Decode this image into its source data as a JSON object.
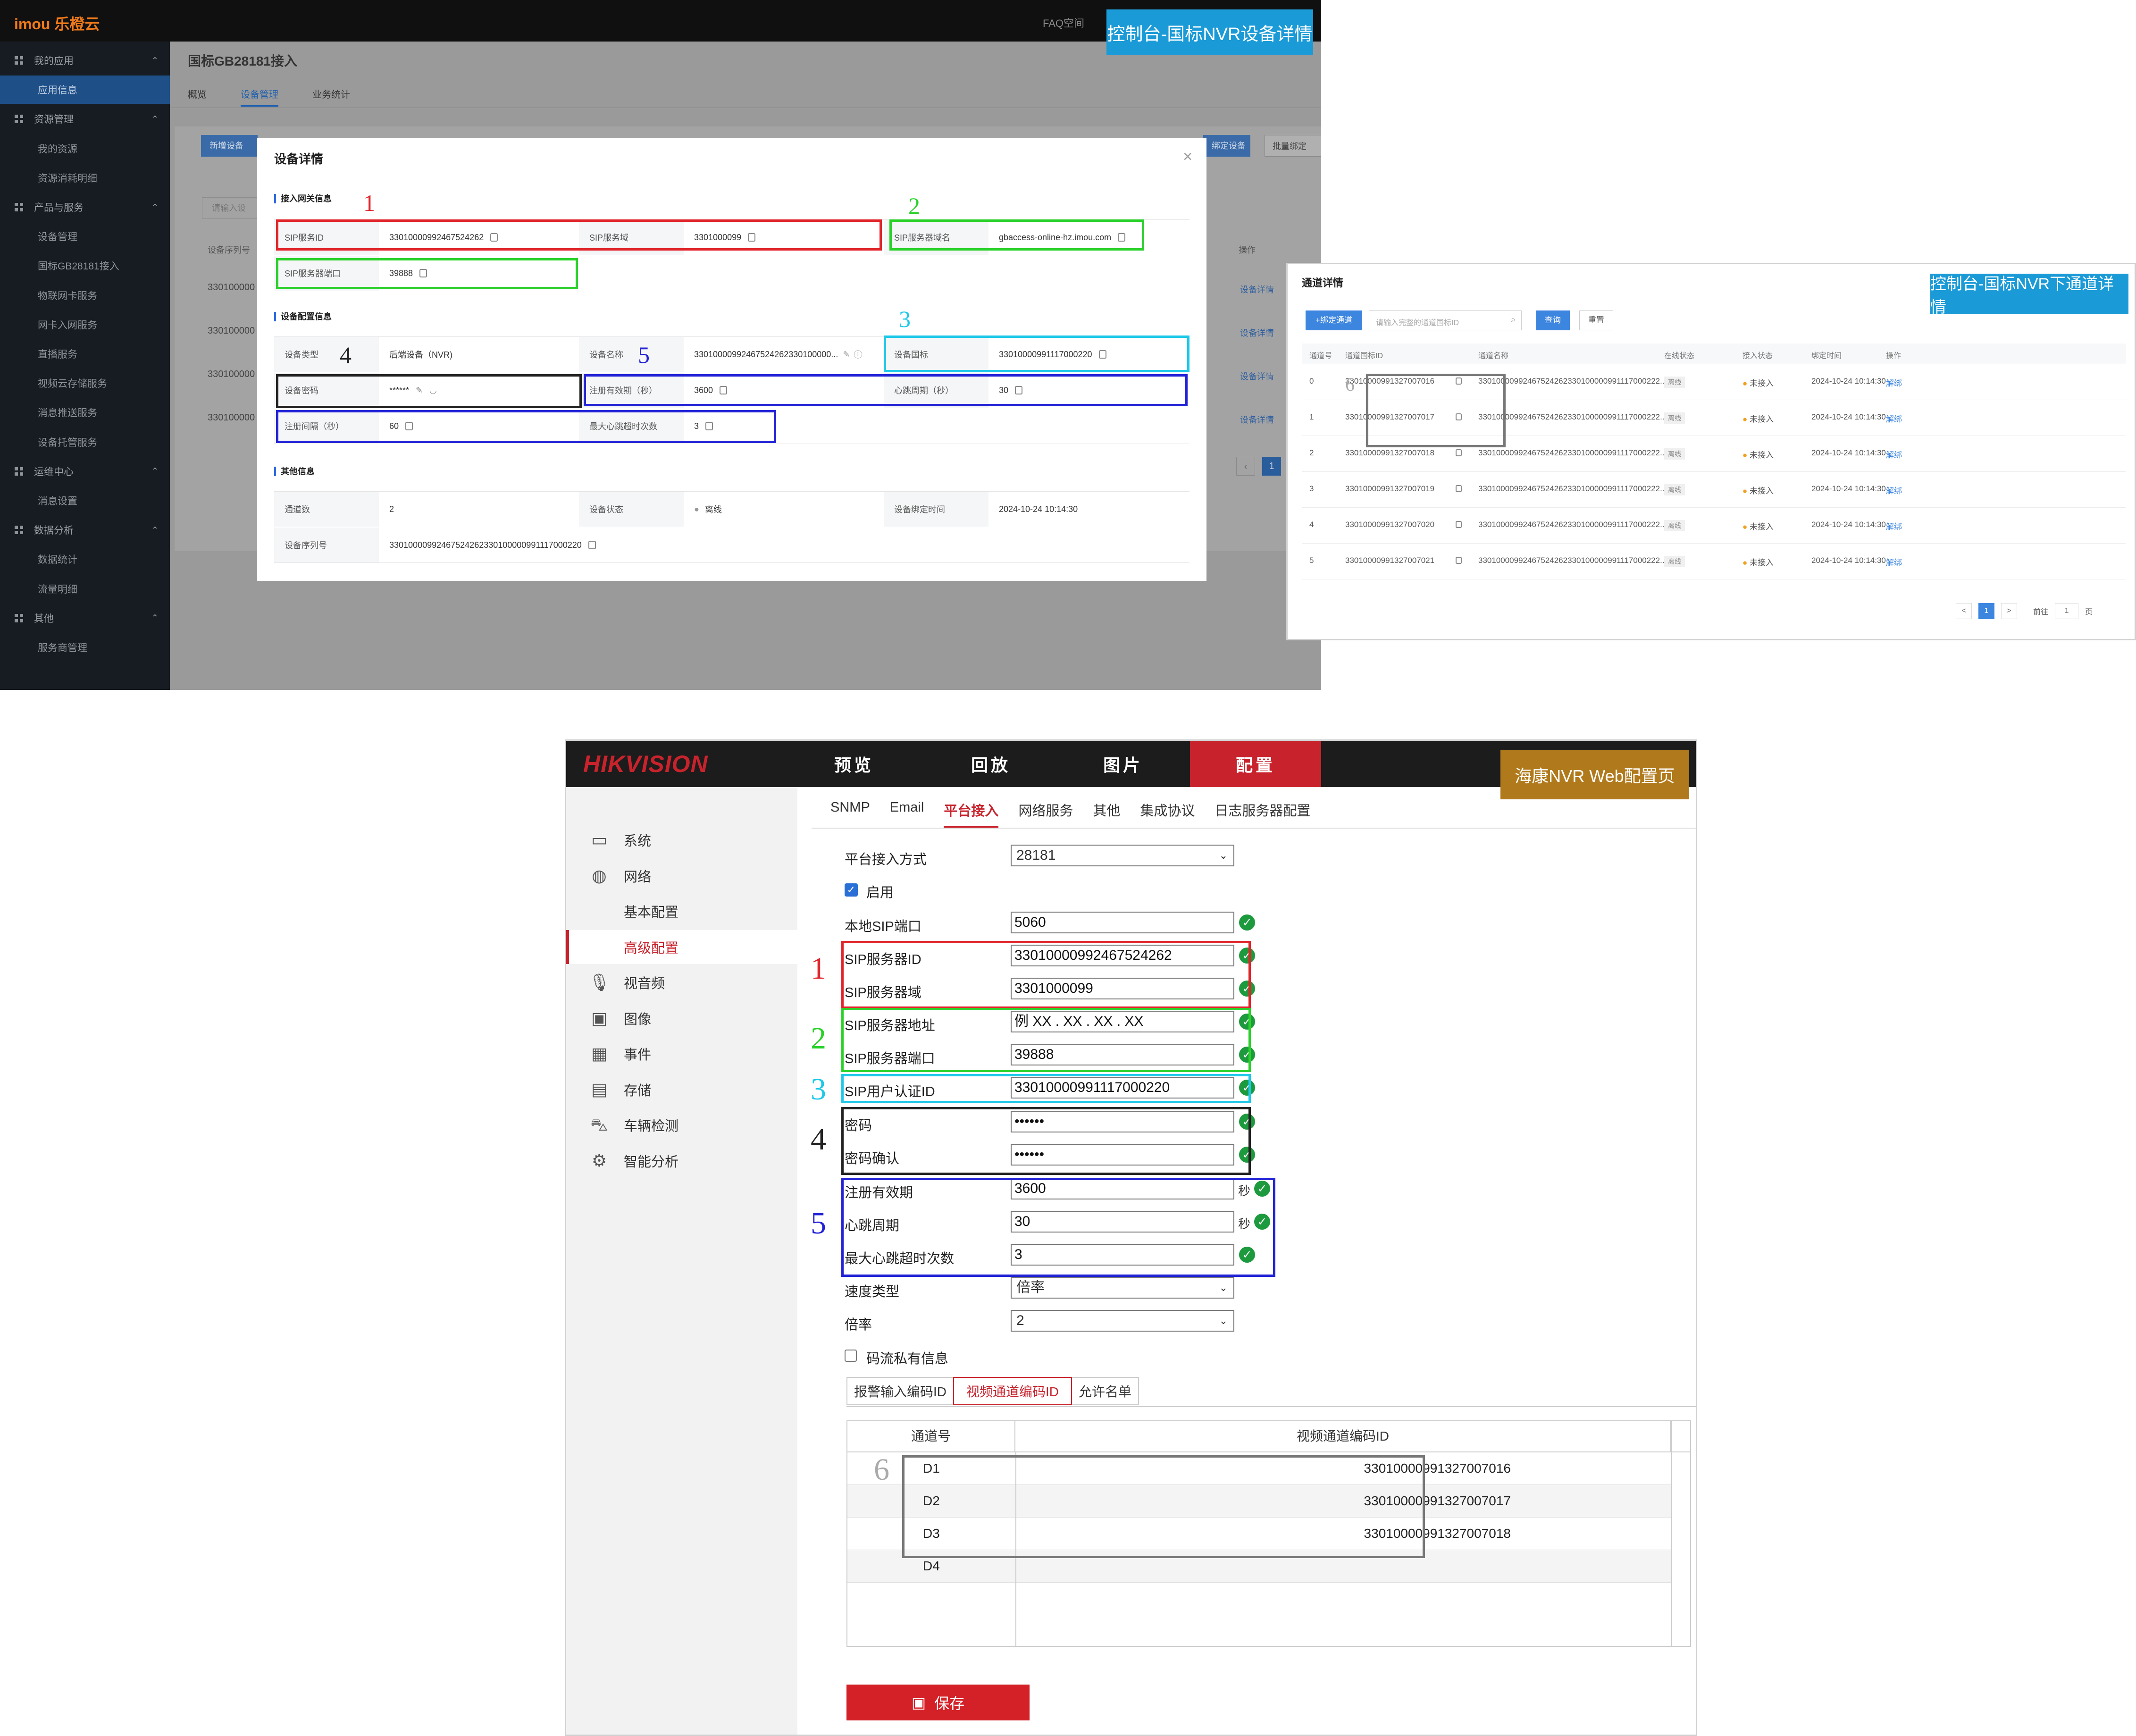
{
  "imou": {
    "brand": "imou 乐橙云",
    "faq": "FAQ空间",
    "caption": "控制台-国标NVR设备详情",
    "sidebar": [
      {
        "label": "我的应用",
        "type": "group",
        "icon": "apps-icon"
      },
      {
        "label": "应用信息",
        "type": "sub",
        "active": true
      },
      {
        "label": "资源管理",
        "type": "group",
        "icon": "resource-icon"
      },
      {
        "label": "我的资源",
        "type": "sub"
      },
      {
        "label": "资源消耗明细",
        "type": "sub"
      },
      {
        "label": "产品与服务",
        "type": "group",
        "icon": "product-icon"
      },
      {
        "label": "设备管理",
        "type": "sub"
      },
      {
        "label": "国标GB28181接入",
        "type": "sub"
      },
      {
        "label": "物联网卡服务",
        "type": "sub"
      },
      {
        "label": "网卡入网服务",
        "type": "sub"
      },
      {
        "label": "直播服务",
        "type": "sub"
      },
      {
        "label": "视频云存储服务",
        "type": "sub"
      },
      {
        "label": "消息推送服务",
        "type": "sub"
      },
      {
        "label": "设备托管服务",
        "type": "sub"
      },
      {
        "label": "运维中心",
        "type": "group",
        "icon": "ops-icon"
      },
      {
        "label": "消息设置",
        "type": "sub"
      },
      {
        "label": "数据分析",
        "type": "group",
        "icon": "chart-icon"
      },
      {
        "label": "数据统计",
        "type": "sub"
      },
      {
        "label": "流量明细",
        "type": "sub"
      },
      {
        "label": "其他",
        "type": "group",
        "icon": "other-icon"
      },
      {
        "label": "服务商管理",
        "type": "sub"
      }
    ],
    "page_title": "国标GB28181接入",
    "tabs": [
      "概览",
      "设备管理",
      "业务统计"
    ],
    "bg_buttons": [
      "新增设备",
      "绑定设备",
      "批量绑定"
    ],
    "bg_search_placeholder": "请输入设",
    "bg_col_serial": "设备序列号",
    "bg_col_op": "操作",
    "bg_rows": [
      "330100000",
      "330100000",
      "330100000",
      "330100000"
    ],
    "bg_op": "设备详情",
    "bg_page": "1",
    "modal": {
      "title": "设备详情",
      "close": "×",
      "sections": [
        "接入网关信息",
        "设备配置信息",
        "其他信息"
      ],
      "gw": {
        "sip_id_label": "SIP服务ID",
        "sip_id": "33010000992467524262",
        "sip_domain_label": "SIP服务域",
        "sip_domain": "3301000099",
        "sip_host_label": "SIP服务器域名",
        "sip_host": "gbaccess-online-hz.imou.com",
        "sip_port_label": "SIP服务器端口",
        "sip_port": "39888"
      },
      "cfg": {
        "type_label": "设备类型",
        "type": "后端设备（NVR)",
        "name_label": "设备名称",
        "name": "33010000992467524262330100000...",
        "gbid_label": "设备国标",
        "gbid": "33010000991117000220",
        "pwd_label": "设备密码",
        "pwd": "******",
        "reg_label": "注册有效期（秒）",
        "reg": "3600",
        "hb_label": "心跳周期（秒）",
        "hb": "30",
        "regc_label": "注册间隔（秒）",
        "regc": "60",
        "maxhb_label": "最大心跳超时次数",
        "maxhb": "3"
      },
      "other": {
        "ch_label": "通道数",
        "ch": "2",
        "status_label": "设备状态",
        "status": "离线",
        "bind_label": "设备绑定时间",
        "bind": "2024-10-24 10:14:30",
        "serial_label": "设备序列号",
        "serial": "33010000992467524262330100000991117000220"
      }
    }
  },
  "channels": {
    "caption": "控制台-国标NVR下通道详情",
    "title": "通道详情",
    "bind_button": "+绑定通道",
    "search_placeholder": "请输入完整的通道国标ID",
    "query": "查询",
    "reset": "重置",
    "columns": [
      "通道号",
      "通道国标ID",
      "通道名称",
      "在线状态",
      "接入状态",
      "绑定时间",
      "操作"
    ],
    "rows": [
      {
        "no": "0",
        "gbid": "33010000991327007016",
        "name": "33010000992467524262330100000991117000222...",
        "online": "离线",
        "access": "未接入",
        "time": "2024-10-24 10:14:30",
        "op": "解绑"
      },
      {
        "no": "1",
        "gbid": "33010000991327007017",
        "name": "33010000992467524262330100000991117000222...",
        "online": "离线",
        "access": "未接入",
        "time": "2024-10-24 10:14:30",
        "op": "解绑"
      },
      {
        "no": "2",
        "gbid": "33010000991327007018",
        "name": "33010000992467524262330100000991117000222...",
        "online": "离线",
        "access": "未接入",
        "time": "2024-10-24 10:14:30",
        "op": "解绑"
      },
      {
        "no": "3",
        "gbid": "33010000991327007019",
        "name": "33010000992467524262330100000991117000222...",
        "online": "离线",
        "access": "未接入",
        "time": "2024-10-24 10:14:30",
        "op": "解绑"
      },
      {
        "no": "4",
        "gbid": "33010000991327007020",
        "name": "33010000992467524262330100000991117000222...",
        "online": "离线",
        "access": "未接入",
        "time": "2024-10-24 10:14:30",
        "op": "解绑"
      },
      {
        "no": "5",
        "gbid": "33010000991327007021",
        "name": "33010000992467524262330100000991117000222...",
        "online": "离线",
        "access": "未接入",
        "time": "2024-10-24 10:14:30",
        "op": "解绑"
      }
    ],
    "pager": {
      "prev": "<",
      "page": "1",
      "next": ">",
      "goto": "前往",
      "goto_val": "1",
      "unit": "页"
    }
  },
  "hik": {
    "brand": "HIKVISION",
    "caption": "海康NVR Web配置页",
    "nav": [
      "预览",
      "回放",
      "图片",
      "配置"
    ],
    "sidebar": [
      {
        "label": "系统",
        "icon": "monitor-icon"
      },
      {
        "label": "网络",
        "icon": "globe-icon"
      },
      {
        "label": "基本配置",
        "sub": true
      },
      {
        "label": "高级配置",
        "sub": true,
        "active": true
      },
      {
        "label": "视音频",
        "icon": "mic-icon"
      },
      {
        "label": "图像",
        "icon": "image-icon"
      },
      {
        "label": "事件",
        "icon": "calendar-icon"
      },
      {
        "label": "存储",
        "icon": "storage-icon"
      },
      {
        "label": "车辆检测",
        "icon": "car-icon"
      },
      {
        "label": "智能分析",
        "icon": "analytics-icon"
      }
    ],
    "tabs": [
      "SNMP",
      "Email",
      "平台接入",
      "网络服务",
      "其他",
      "集成协议",
      "日志服务器配置"
    ],
    "form": {
      "mode_label": "平台接入方式",
      "mode": "28181",
      "enable_label": "启用",
      "local_port_label": "本地SIP端口",
      "local_port": "5060",
      "sip_id_label": "SIP服务器ID",
      "sip_id": "33010000992467524262",
      "sip_domain_label": "SIP服务器域",
      "sip_domain": "3301000099",
      "sip_addr_label": "SIP服务器地址",
      "sip_addr": "例 XX . XX . XX . XX",
      "sip_port_label": "SIP服务器端口",
      "sip_port": "39888",
      "auth_label": "SIP用户认证ID",
      "auth": "33010000991117000220",
      "pwd_label": "密码",
      "pwd": "••••••",
      "pwd2_label": "密码确认",
      "pwd2": "••••••",
      "reg_label": "注册有效期",
      "reg": "3600",
      "hb_label": "心跳周期",
      "hb": "30",
      "maxhb_label": "最大心跳超时次数",
      "maxhb": "3",
      "sec": "秒",
      "speed_label": "速度类型",
      "speed": "倍率",
      "rate_label": "倍率",
      "rate": "2",
      "private_label": "码流私有信息"
    },
    "subtabs": [
      "报警输入编码ID",
      "视频通道编码ID",
      "允许名单"
    ],
    "table": {
      "cols": [
        "通道号",
        "视频通道编码ID"
      ],
      "rows": [
        {
          "ch": "D1",
          "id": "33010000991327007016"
        },
        {
          "ch": "D2",
          "id": "33010000991327007017"
        },
        {
          "ch": "D3",
          "id": "33010000991327007018"
        },
        {
          "ch": "D4",
          "id": ""
        }
      ]
    },
    "save": "保存"
  },
  "markers": [
    "1",
    "2",
    "3",
    "4",
    "5",
    "6"
  ],
  "colors": {
    "red": "#e0252b",
    "green": "#2bd12b",
    "cyan": "#1ec8e8",
    "black": "#222222",
    "blue": "#2222d6",
    "gray": "#777777",
    "caption_blue": "#1a9ad6",
    "caption_gold": "#b07a1c",
    "hik_red": "#c8232c"
  }
}
